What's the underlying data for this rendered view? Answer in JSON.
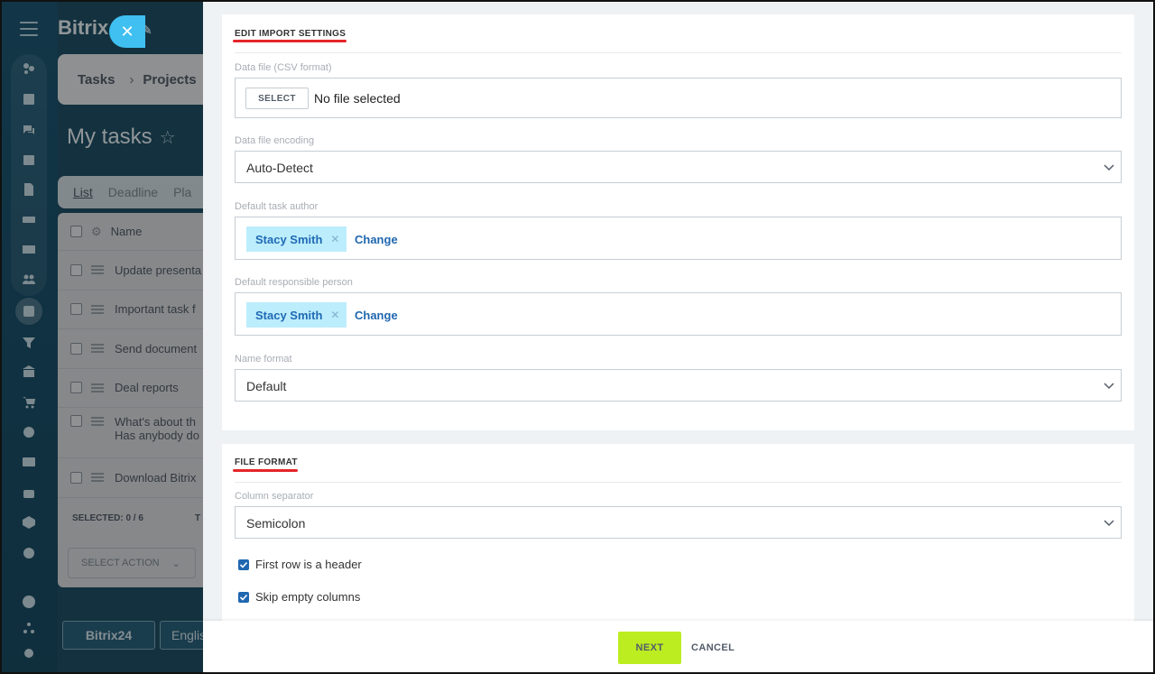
{
  "background": {
    "brand": {
      "name": "Bitrix",
      "num": "24"
    },
    "breadcrumbs": [
      "Tasks",
      "Projects"
    ],
    "page_title": "My tasks",
    "tabs": [
      "List",
      "Deadline",
      "Pla"
    ],
    "list_header": "Name",
    "rows": [
      {
        "text": "Update presenta"
      },
      {
        "text": "Important task f"
      },
      {
        "text": "Send document"
      },
      {
        "text": "Deal reports"
      },
      {
        "text": "What's about th",
        "text2": "Has anybody do"
      },
      {
        "text": "Download Bitrix"
      }
    ],
    "selected_label": "SELECTED: 0 / 6",
    "selected_label2": "T",
    "select_action": "SELECT ACTION",
    "footer_brand": "Bitrix24",
    "footer_lang": "Englis"
  },
  "panel": {
    "import_settings": {
      "title": "EDIT IMPORT SETTINGS",
      "data_file_label": "Data file (CSV format)",
      "select_button": "SELECT",
      "no_file": "No file selected",
      "encoding_label": "Data file encoding",
      "encoding_value": "Auto-Detect",
      "author_label": "Default task author",
      "author_tag": "Stacy Smith",
      "author_change": "Change",
      "responsible_label": "Default responsible person",
      "responsible_tag": "Stacy Smith",
      "responsible_change": "Change",
      "name_format_label": "Name format",
      "name_format_value": "Default"
    },
    "file_format": {
      "title": "FILE FORMAT",
      "separator_label": "Column separator",
      "separator_value": "Semicolon",
      "first_row_header": "First row is a header",
      "first_row_header_checked": true,
      "skip_empty": "Skip empty columns",
      "skip_empty_checked": true
    },
    "footer": {
      "next": "NEXT",
      "cancel": "CANCEL"
    }
  },
  "colors": {
    "accent": "#2067b0",
    "next_button": "#bbed21",
    "underline": "#e5252a",
    "tag_bg": "#bcedfc"
  }
}
